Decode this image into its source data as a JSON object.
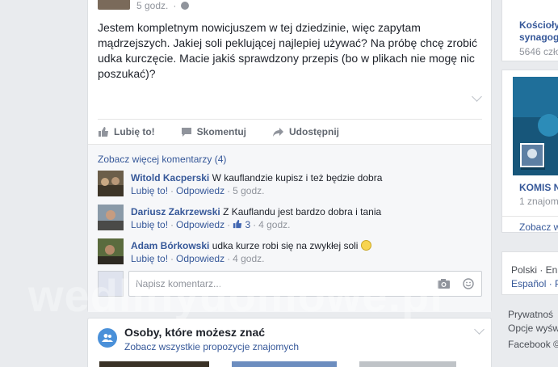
{
  "post": {
    "time": "5 godz.",
    "text": "Jestem kompletnym nowicjuszem w tej dziedzinie, więc zapytam mądrzejszych. Jakiej soli peklującej najlepiej używać? Na próbę chcę zrobić udka kurczęcie. Macie jakiś sprawdzony przepis (bo w plikach nie mogę nic poszukać)?",
    "actions": {
      "like": "Lubię to!",
      "comment": "Skomentuj",
      "share": "Udostępnij"
    }
  },
  "comments": {
    "see_more": "Zobacz więcej komentarzy (4)",
    "items": [
      {
        "author": "Witold Kacperski",
        "text": "W kauflandzie kupisz i też będzie dobra",
        "like": "Lubię to!",
        "reply": "Odpowiedz",
        "time": "5 godz.",
        "likes": ""
      },
      {
        "author": "Dariusz Zakrzewski",
        "text": "Z Kauflandu jest bardzo dobra i tania",
        "like": "Lubię to!",
        "reply": "Odpowiedz",
        "time": "4 godz.",
        "likes": "3"
      },
      {
        "author": "Adam Bórkowski",
        "text": "udka kurze robi się na zwykłej soli",
        "like": "Lubię to!",
        "reply": "Odpowiedz",
        "time": "4 godz.",
        "likes": ""
      }
    ],
    "input_placeholder": "Napisz komentarz..."
  },
  "pymk": {
    "title": "Osoby, które możesz znać",
    "subtitle": "Zobacz wszystkie propozycje znajomych"
  },
  "sidebar": {
    "card1_title_line1": "Kościoły",
    "card1_title_line2": "synagog",
    "card1_meta": "5646 czło",
    "card2_title": "KOMIS N",
    "card2_meta": "1 znajom",
    "see_all": "Zobacz wsz",
    "lang_line1": "Polski · En",
    "lang_line2": "Español · P",
    "footer_line1": "Prywatnoś",
    "footer_line2": "Opcje wyśw",
    "footer_line3": "Facebook ©"
  },
  "watermark": "wedlinydomowe.pl"
}
